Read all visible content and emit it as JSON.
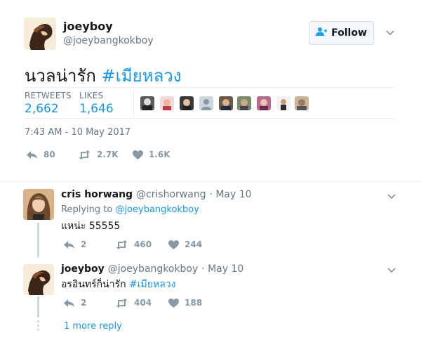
{
  "main_tweet": {
    "display_name": "joeyboy",
    "handle": "@joeybangkokboy",
    "follow_label": "Follow",
    "text": "นวลน่ารัก",
    "hashtag": "#เมียหลวง",
    "stats": {
      "retweets_label": "RETWEETS",
      "retweets_value": "2,662",
      "likes_label": "LIKES",
      "likes_value": "1,646"
    },
    "timestamp": "7:43 AM - 10 May 2017",
    "actions": {
      "replies": "80",
      "retweets": "2.7K",
      "likes": "1.6K"
    }
  },
  "replies": [
    {
      "display_name": "cris horwang",
      "handle": "@crishorwang",
      "date": "· May 10",
      "replying_prefix": "Replying to",
      "replying_handle": "@joeybangkokboy",
      "text": "แหน่ะ 55555",
      "actions": {
        "replies": "2",
        "retweets": "460",
        "likes": "244"
      }
    },
    {
      "display_name": "joeyboy",
      "handle": "@joeybangkokboy",
      "date": "· May 10",
      "text": "อรอินทร์ก็น่ารัก",
      "hashtag": "#เมียหลวง",
      "actions": {
        "replies": "2",
        "retweets": "404",
        "likes": "188"
      }
    }
  ],
  "more_reply": "1 more reply",
  "colors": {
    "link": "#1b95e0",
    "secondary_text": "#657786",
    "icon": "#8899a6",
    "divider": "#e6ecf0",
    "thread_line": "#ccd6dd"
  }
}
